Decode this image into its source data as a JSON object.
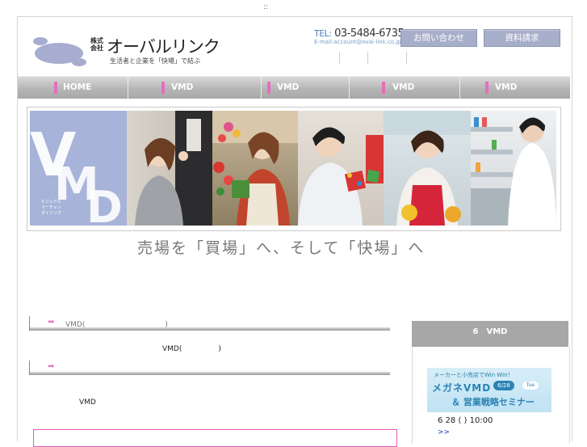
{
  "topbar": {
    "dots": "::"
  },
  "header": {
    "kabushiki": "株式会社",
    "company_name": "オーバルリンク",
    "tagline": "生活者と企業を「快場」で結ぶ",
    "tel_label": "TEL:",
    "tel_number": "03-5484-6735",
    "email_label": "E-mail:",
    "email": "account@oval-link.co.jp",
    "contact_button": "お問い合わせ",
    "request_button": "資料請求"
  },
  "nav": {
    "items": [
      {
        "label": "HOME"
      },
      {
        "label": "VMD"
      },
      {
        "label": "VMD"
      },
      {
        "label": "VMD"
      },
      {
        "label": "VMD"
      }
    ],
    "accent": "#e66dbd"
  },
  "hero": {
    "panel_letters": "VMD",
    "panel_small": [
      "ビジュアル",
      "マーチャン",
      "ダイジング"
    ],
    "headline": "売場を「買場」へ、そして「快場」へ"
  },
  "content": {
    "section1_title": "VMD(　　　　　　　　　　　)",
    "section1_text": "VMD(　　　　　)",
    "section2_title": "",
    "body_text": "VMD"
  },
  "sidebar": {
    "heading": "6　VMD",
    "banner_top": "メーカーと小売店でWin Win！",
    "banner_main": "メガネVMD",
    "banner_date": "6/28",
    "banner_dow": "Tue",
    "banner_sub": "＆ 営業戦略セミナー",
    "event_date": "6 28 ( ) 10:00",
    "more_link": ">>"
  }
}
